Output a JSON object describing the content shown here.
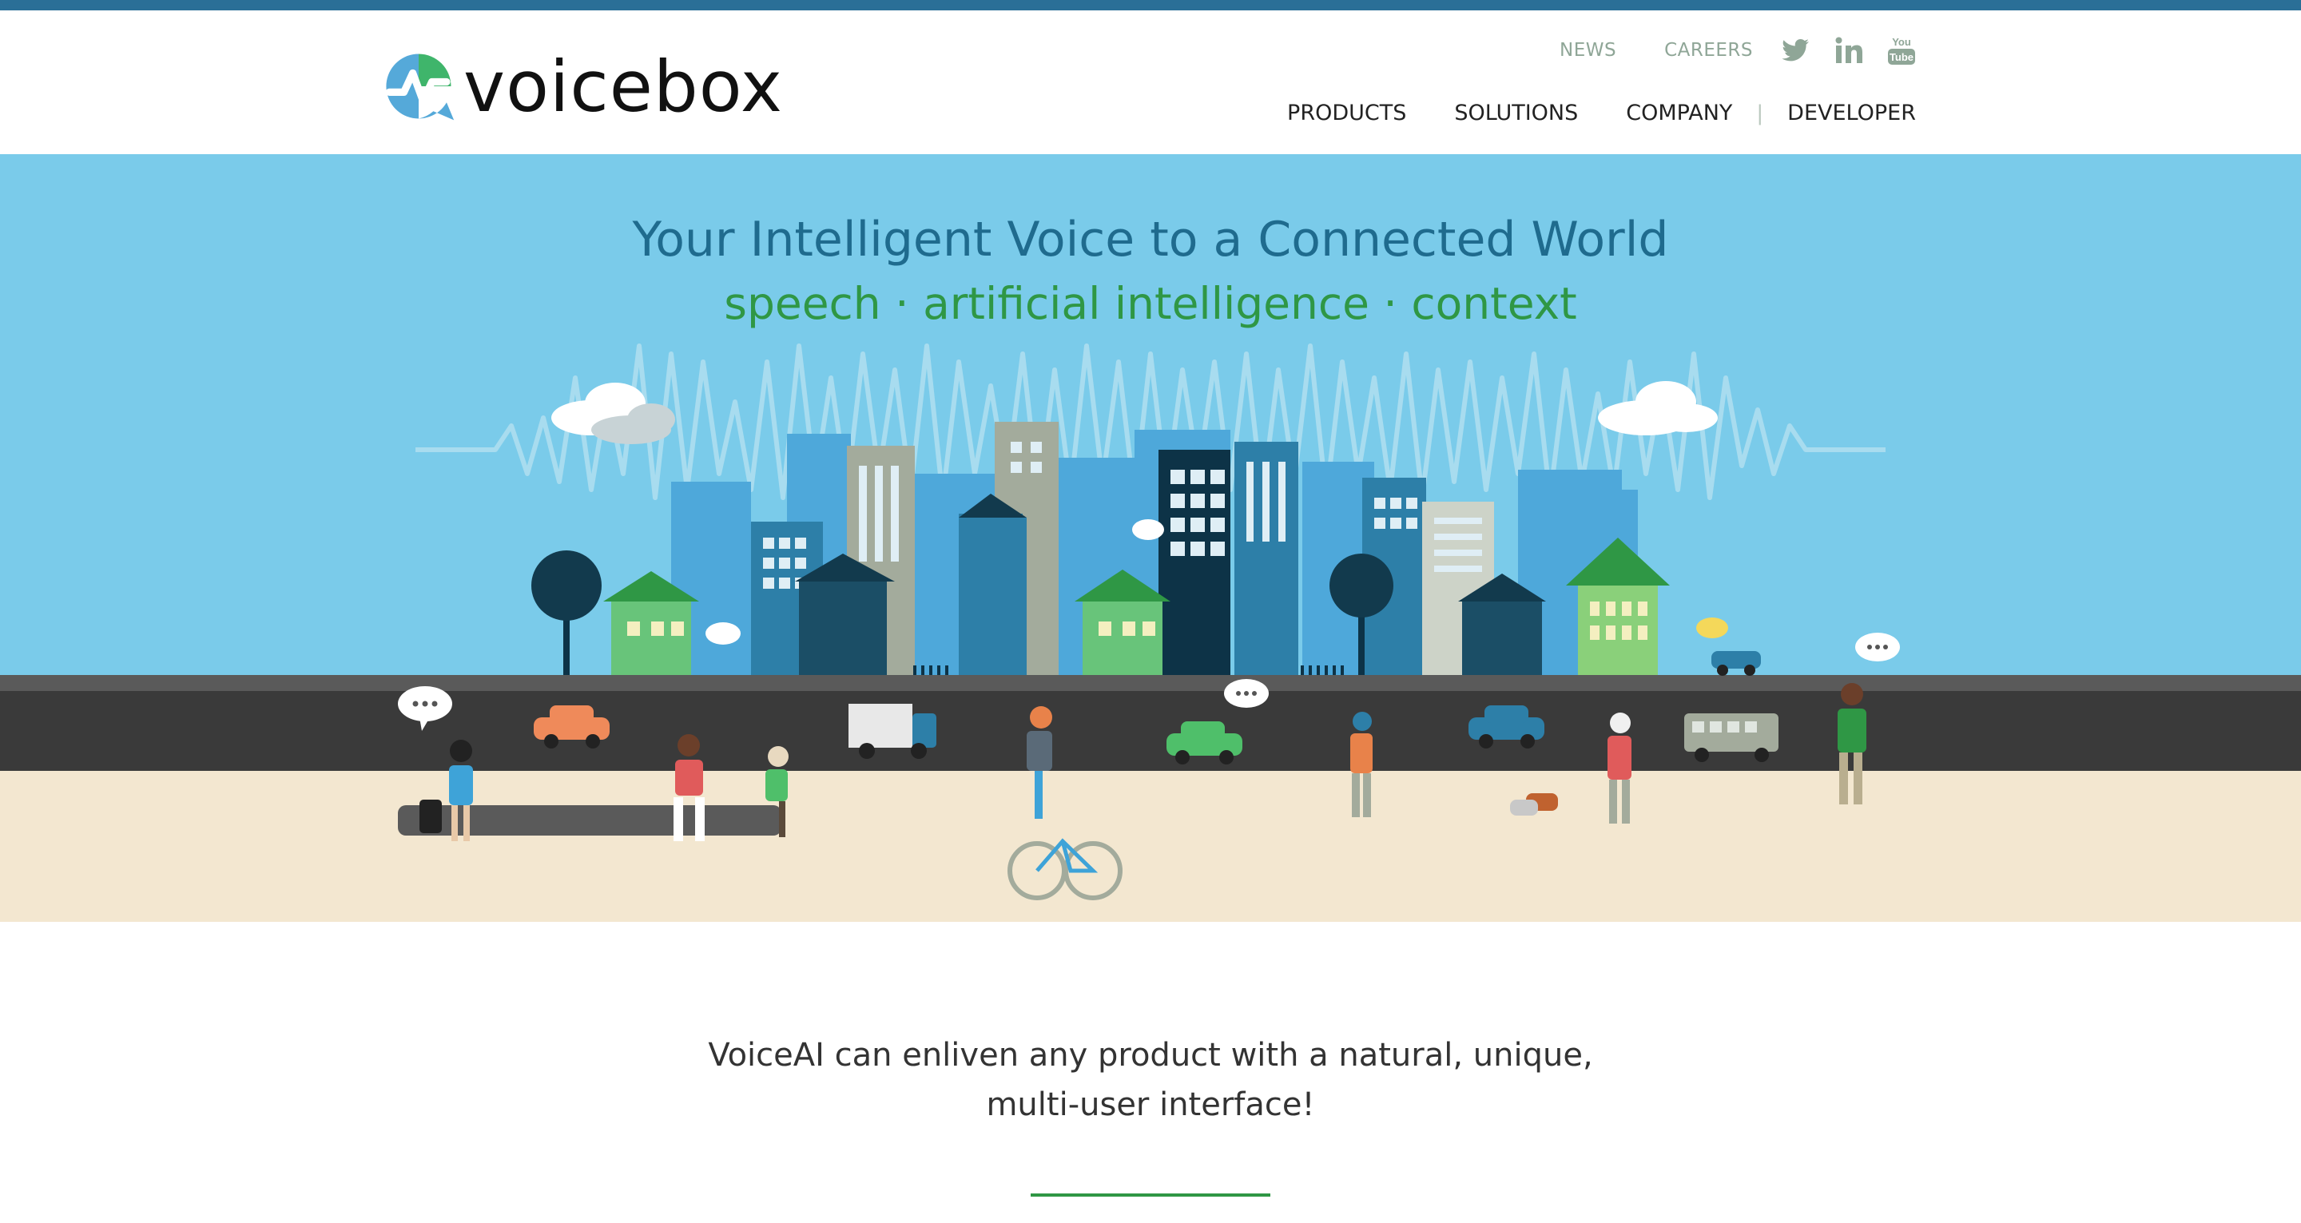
{
  "brand": {
    "name": "voicebox",
    "logo_icon": "voicebox-logo-mark"
  },
  "utility_nav": {
    "news": "NEWS",
    "careers": "CAREERS"
  },
  "social": [
    {
      "icon": "twitter-icon"
    },
    {
      "icon": "linkedin-icon"
    },
    {
      "icon": "youtube-icon"
    }
  ],
  "main_nav": {
    "products": "PRODUCTS",
    "solutions": "SOLUTIONS",
    "company": "COMPANY",
    "developer": "DEVELOPER"
  },
  "hero": {
    "title": "Your Intelligent Voice to a Connected World",
    "subtitle": "speech · artificial intelligence · context"
  },
  "intro": {
    "text": "VoiceAI can enliven any product with a natural, unique, multi-user interface!"
  },
  "colors": {
    "top_bar": "#2a6f97",
    "hero_sky": "#7acbea",
    "title_blue": "#1f6b8e",
    "accent_green": "#2f9745",
    "road": "#3a3a3a",
    "sidewalk": "#f3e7d0"
  }
}
